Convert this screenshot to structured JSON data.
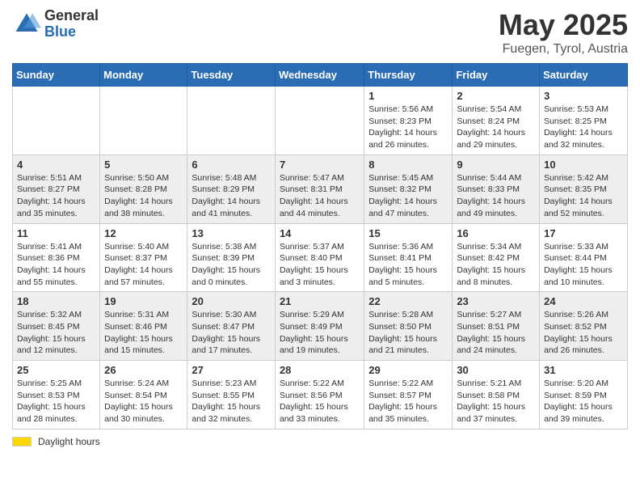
{
  "header": {
    "logo_general": "General",
    "logo_blue": "Blue",
    "month": "May 2025",
    "location": "Fuegen, Tyrol, Austria"
  },
  "weekdays": [
    "Sunday",
    "Monday",
    "Tuesday",
    "Wednesday",
    "Thursday",
    "Friday",
    "Saturday"
  ],
  "footer": {
    "legend_label": "Daylight hours"
  },
  "weeks": [
    [
      {
        "day": "",
        "info": ""
      },
      {
        "day": "",
        "info": ""
      },
      {
        "day": "",
        "info": ""
      },
      {
        "day": "",
        "info": ""
      },
      {
        "day": "1",
        "info": "Sunrise: 5:56 AM\nSunset: 8:23 PM\nDaylight: 14 hours\nand 26 minutes."
      },
      {
        "day": "2",
        "info": "Sunrise: 5:54 AM\nSunset: 8:24 PM\nDaylight: 14 hours\nand 29 minutes."
      },
      {
        "day": "3",
        "info": "Sunrise: 5:53 AM\nSunset: 8:25 PM\nDaylight: 14 hours\nand 32 minutes."
      }
    ],
    [
      {
        "day": "4",
        "info": "Sunrise: 5:51 AM\nSunset: 8:27 PM\nDaylight: 14 hours\nand 35 minutes."
      },
      {
        "day": "5",
        "info": "Sunrise: 5:50 AM\nSunset: 8:28 PM\nDaylight: 14 hours\nand 38 minutes."
      },
      {
        "day": "6",
        "info": "Sunrise: 5:48 AM\nSunset: 8:29 PM\nDaylight: 14 hours\nand 41 minutes."
      },
      {
        "day": "7",
        "info": "Sunrise: 5:47 AM\nSunset: 8:31 PM\nDaylight: 14 hours\nand 44 minutes."
      },
      {
        "day": "8",
        "info": "Sunrise: 5:45 AM\nSunset: 8:32 PM\nDaylight: 14 hours\nand 47 minutes."
      },
      {
        "day": "9",
        "info": "Sunrise: 5:44 AM\nSunset: 8:33 PM\nDaylight: 14 hours\nand 49 minutes."
      },
      {
        "day": "10",
        "info": "Sunrise: 5:42 AM\nSunset: 8:35 PM\nDaylight: 14 hours\nand 52 minutes."
      }
    ],
    [
      {
        "day": "11",
        "info": "Sunrise: 5:41 AM\nSunset: 8:36 PM\nDaylight: 14 hours\nand 55 minutes."
      },
      {
        "day": "12",
        "info": "Sunrise: 5:40 AM\nSunset: 8:37 PM\nDaylight: 14 hours\nand 57 minutes."
      },
      {
        "day": "13",
        "info": "Sunrise: 5:38 AM\nSunset: 8:39 PM\nDaylight: 15 hours\nand 0 minutes."
      },
      {
        "day": "14",
        "info": "Sunrise: 5:37 AM\nSunset: 8:40 PM\nDaylight: 15 hours\nand 3 minutes."
      },
      {
        "day": "15",
        "info": "Sunrise: 5:36 AM\nSunset: 8:41 PM\nDaylight: 15 hours\nand 5 minutes."
      },
      {
        "day": "16",
        "info": "Sunrise: 5:34 AM\nSunset: 8:42 PM\nDaylight: 15 hours\nand 8 minutes."
      },
      {
        "day": "17",
        "info": "Sunrise: 5:33 AM\nSunset: 8:44 PM\nDaylight: 15 hours\nand 10 minutes."
      }
    ],
    [
      {
        "day": "18",
        "info": "Sunrise: 5:32 AM\nSunset: 8:45 PM\nDaylight: 15 hours\nand 12 minutes."
      },
      {
        "day": "19",
        "info": "Sunrise: 5:31 AM\nSunset: 8:46 PM\nDaylight: 15 hours\nand 15 minutes."
      },
      {
        "day": "20",
        "info": "Sunrise: 5:30 AM\nSunset: 8:47 PM\nDaylight: 15 hours\nand 17 minutes."
      },
      {
        "day": "21",
        "info": "Sunrise: 5:29 AM\nSunset: 8:49 PM\nDaylight: 15 hours\nand 19 minutes."
      },
      {
        "day": "22",
        "info": "Sunrise: 5:28 AM\nSunset: 8:50 PM\nDaylight: 15 hours\nand 21 minutes."
      },
      {
        "day": "23",
        "info": "Sunrise: 5:27 AM\nSunset: 8:51 PM\nDaylight: 15 hours\nand 24 minutes."
      },
      {
        "day": "24",
        "info": "Sunrise: 5:26 AM\nSunset: 8:52 PM\nDaylight: 15 hours\nand 26 minutes."
      }
    ],
    [
      {
        "day": "25",
        "info": "Sunrise: 5:25 AM\nSunset: 8:53 PM\nDaylight: 15 hours\nand 28 minutes."
      },
      {
        "day": "26",
        "info": "Sunrise: 5:24 AM\nSunset: 8:54 PM\nDaylight: 15 hours\nand 30 minutes."
      },
      {
        "day": "27",
        "info": "Sunrise: 5:23 AM\nSunset: 8:55 PM\nDaylight: 15 hours\nand 32 minutes."
      },
      {
        "day": "28",
        "info": "Sunrise: 5:22 AM\nSunset: 8:56 PM\nDaylight: 15 hours\nand 33 minutes."
      },
      {
        "day": "29",
        "info": "Sunrise: 5:22 AM\nSunset: 8:57 PM\nDaylight: 15 hours\nand 35 minutes."
      },
      {
        "day": "30",
        "info": "Sunrise: 5:21 AM\nSunset: 8:58 PM\nDaylight: 15 hours\nand 37 minutes."
      },
      {
        "day": "31",
        "info": "Sunrise: 5:20 AM\nSunset: 8:59 PM\nDaylight: 15 hours\nand 39 minutes."
      }
    ]
  ]
}
